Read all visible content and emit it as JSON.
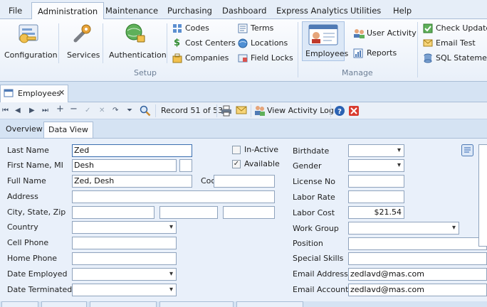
{
  "menu": {
    "tabs": [
      "File",
      "Administration",
      "Maintenance",
      "Purchasing",
      "Dashboard",
      "Express Analytics",
      "Utilities",
      "Help"
    ]
  },
  "ribbon": {
    "configuration": "Configuration",
    "services": "Services",
    "authentication": "Authentication",
    "codes": "Codes",
    "cost_centers": "Cost Centers",
    "companies": "Companies",
    "terms": "Terms",
    "locations": "Locations",
    "field_locks": "Field Locks",
    "employees": "Employees",
    "user_activity": "User Activity",
    "reports": "Reports",
    "check_updates": "Check Updates",
    "email_test": "Email Test",
    "sql_statement": "SQL Statement",
    "group_setup": "Setup",
    "group_manage": "Manage"
  },
  "doc_tab": {
    "label": "Employees",
    "close": "✕"
  },
  "toolbar": {
    "record": "Record 51 of 53",
    "view_activity_log": "View Activity Log"
  },
  "subtabs": [
    "Overview",
    "Data View"
  ],
  "form": {
    "labels": {
      "last_name": "Last Name",
      "first_name_mi": "First Name, MI",
      "full_name": "Full Name",
      "address": "Address",
      "city_state_zip": "City, State, Zip",
      "country": "Country",
      "cell_phone": "Cell Phone",
      "home_phone": "Home Phone",
      "date_employed": "Date Employed",
      "date_terminated": "Date Terminated",
      "in_active": "In-Active",
      "available": "Available",
      "code": "Coc",
      "birthdate": "Birthdate",
      "gender": "Gender",
      "license_no": "License No",
      "labor_rate": "Labor Rate",
      "labor_cost": "Labor Cost",
      "work_group": "Work Group",
      "position": "Position",
      "special_skills": "Special Skills",
      "email_address": "Email Address",
      "email_account": "Email Account"
    },
    "values": {
      "last_name": "Zed",
      "first_name": "Desh",
      "mi": "",
      "full_name": "Zed, Desh",
      "code": "",
      "address": "",
      "city": "",
      "state": "",
      "zip": "",
      "country": "",
      "cell_phone": "",
      "home_phone": "",
      "date_employed": "",
      "date_terminated": "",
      "in_active": false,
      "available": true,
      "birthdate": "",
      "gender": "",
      "license_no": "",
      "labor_rate": "",
      "labor_cost": "$21.54",
      "work_group": "",
      "position": "",
      "special_skills": "",
      "email_address": "zedlavd@mas.com",
      "email_account": "zedlavd@mas.com"
    }
  },
  "colors": {
    "accent": "#1f5fa8",
    "ribbon_bg": "#fbfcfe",
    "form_bg": "#e9f0fa",
    "frame_bg": "#d5e3f3"
  }
}
